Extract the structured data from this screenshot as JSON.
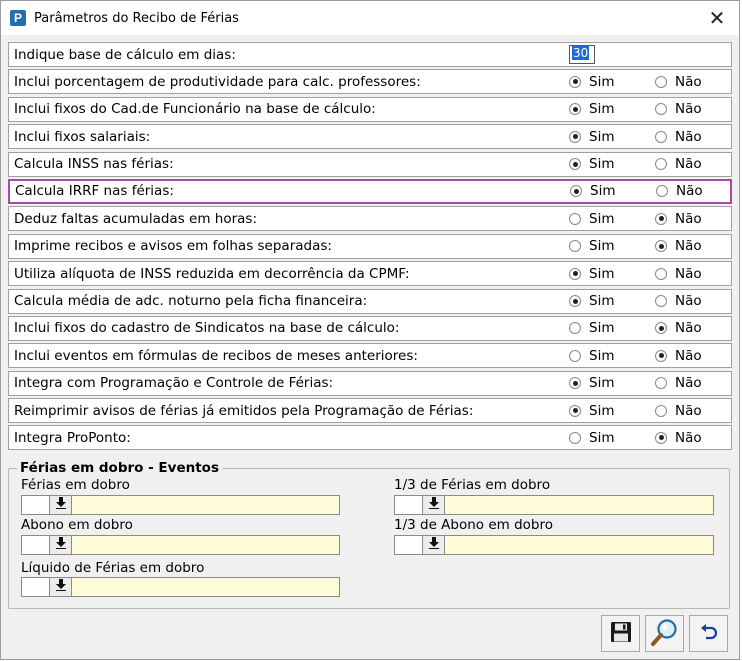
{
  "window": {
    "title": "Parâmetros do Recibo de Férias",
    "app_icon_letter": "P",
    "close_glyph": "✕"
  },
  "radio": {
    "sim_label": "Sim",
    "nao_label": "Não"
  },
  "days_row": {
    "label": "Indique base de cálculo em dias:",
    "value": "30"
  },
  "options": [
    {
      "label": "Inclui porcentagem de produtividade para calc. professores:",
      "selected": "sim",
      "highlighted": false
    },
    {
      "label": "Inclui fixos do Cad.de Funcionário na base de cálculo:",
      "selected": "sim",
      "highlighted": false
    },
    {
      "label": "Inclui fixos salariais:",
      "selected": "sim",
      "highlighted": false
    },
    {
      "label": "Calcula INSS nas férias:",
      "selected": "sim",
      "highlighted": false
    },
    {
      "label": "Calcula IRRF nas férias:",
      "selected": "sim",
      "highlighted": true
    },
    {
      "label": "Deduz faltas acumuladas em horas:",
      "selected": "nao",
      "highlighted": false
    },
    {
      "label": "Imprime recibos e avisos em folhas separadas:",
      "selected": "nao",
      "highlighted": false
    },
    {
      "label": "Utiliza alíquota de INSS reduzida em decorrência da CPMF:",
      "selected": "sim",
      "highlighted": false
    },
    {
      "label": "Calcula média de adc. noturno pela ficha financeira:",
      "selected": "sim",
      "highlighted": false
    },
    {
      "label": "Inclui fixos do cadastro de Sindicatos na base de cálculo:",
      "selected": "nao",
      "highlighted": false
    },
    {
      "label": "Inclui eventos em fórmulas de recibos de meses anteriores:",
      "selected": "nao",
      "highlighted": false
    },
    {
      "label": "Integra com Programação e Controle de Férias:",
      "selected": "sim",
      "highlighted": false
    },
    {
      "label": "Reimprimir avisos de férias já emitidos pela Programação de Férias:",
      "selected": "sim",
      "highlighted": false
    },
    {
      "label": "Integra ProPonto:",
      "selected": "nao",
      "highlighted": false
    }
  ],
  "events_group": {
    "title": "Férias em dobro - Eventos",
    "ferias_em_dobro": {
      "label": "Férias em dobro",
      "code": "",
      "description": ""
    },
    "abono_em_dobro": {
      "label": "Abono em dobro",
      "code": "",
      "description": ""
    },
    "liquido_ferias_em_dobro": {
      "label": "Líquido de Férias em dobro",
      "code": "",
      "description": ""
    },
    "um_terco_ferias_em_dobro": {
      "label": "1/3 de Férias em dobro",
      "code": "",
      "description": ""
    },
    "um_terco_abono_em_dobro": {
      "label": "1/3 de Abono em dobro",
      "code": "",
      "description": ""
    }
  },
  "toolbar": {
    "save_icon": "floppy-disk-icon",
    "search_icon": "magnifier-icon",
    "undo_icon": "undo-arrow-icon"
  },
  "colors": {
    "highlight_border": "#a64ca6",
    "description_field_bg": "#fefbd8",
    "selection_bg": "#1e6bd6",
    "window_bg": "#f0f0f0"
  }
}
